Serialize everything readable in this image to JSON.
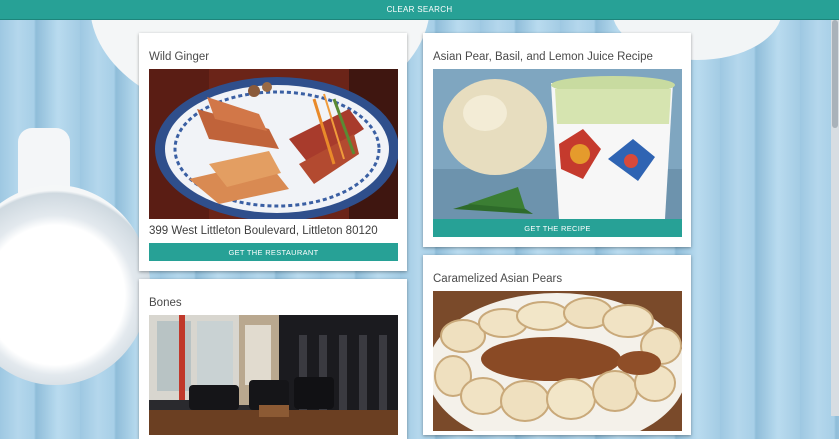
{
  "topbar": {
    "clear_search_label": "CLEAR SEARCH"
  },
  "cards": [
    {
      "title": "Wild Ginger",
      "subtitle": "399 West Littleton Boulevard, Littleton 80120",
      "button_label": "GET THE RESTAURANT"
    },
    {
      "title": "Asian Pear, Basil, and Lemon Juice Recipe",
      "button_label": "GET THE RECIPE"
    },
    {
      "title": "Bones"
    },
    {
      "title": "Caramelized Asian Pears"
    }
  ],
  "colors": {
    "accent": "#27a196",
    "card_background": "#ffffff",
    "page_background": "#a7cfe7"
  },
  "icons": {
    "images": [
      "spring-rolls-photo",
      "pear-juice-photo",
      "restaurant-interior-photo",
      "caramelized-pears-photo"
    ]
  }
}
